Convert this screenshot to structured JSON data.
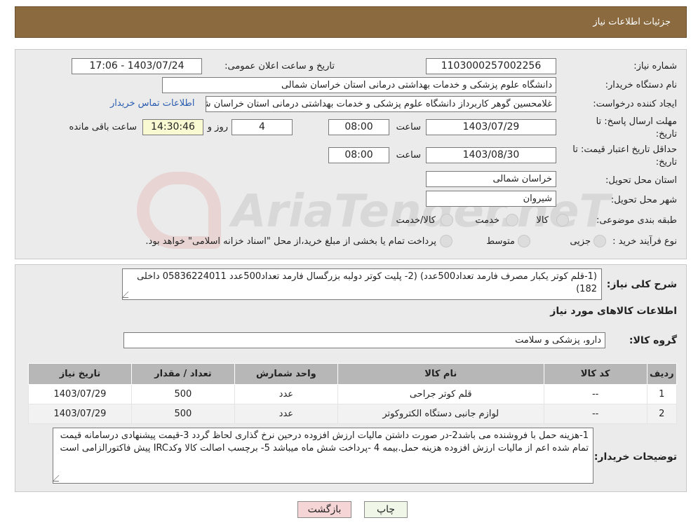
{
  "header": {
    "title": "جزئیات اطلاعات نیاز"
  },
  "form": {
    "need_number_label": "شماره نیاز:",
    "need_number": "1103000257002256",
    "announce_label": "تاریخ و ساعت اعلان عمومی:",
    "announce_value": "1403/07/24 - 17:06",
    "buyer_org_label": "نام دستگاه خریدار:",
    "buyer_org": "دانشگاه علوم پزشکی و خدمات بهداشتی درمانی استان خراسان شمالی",
    "creator_label": "ایجاد کننده درخواست:",
    "creator": "غلامحسین گوهر کاربرداز  دانشگاه علوم پزشکی و خدمات بهداشتی درمانی استان خراسان شمالی",
    "contact_link": "اطلاعات تماس خریدار",
    "deadline_label_1": "مهلت ارسال پاسخ: تا",
    "deadline_label_2": "تاریخ:",
    "deadline_date": "1403/07/29",
    "time_label": "ساعت",
    "deadline_time": "08:00",
    "days_value": "4",
    "days_label": "روز و",
    "remaining_time": "14:30:46",
    "remaining_label": "ساعت باقی مانده",
    "validity_label_1": "حداقل تاریخ اعتبار قیمت: تا",
    "validity_label_2": "تاریخ:",
    "validity_date": "1403/08/30",
    "validity_time": "08:00",
    "province_label": "استان محل تحویل:",
    "province": "خراسان شمالی",
    "city_label": "شهر محل تحویل:",
    "city": "شیروان",
    "category_label": "طبقه بندی موضوعی:",
    "category_options": [
      "کالا",
      "خدمت",
      "کالا/خدمت"
    ],
    "purchase_type_label": "نوع فرآیند خرید :",
    "purchase_options": [
      "جزیی",
      "متوسط"
    ],
    "purchase_note": "پرداخت تمام یا بخشی از مبلغ خرید،از محل \"اسناد خزانه اسلامی\" خواهد بود."
  },
  "details": {
    "summary_label": "شرح کلی نیاز:",
    "summary": "(1-قلم کوتر یکبار مصرف فارمد تعداد500عدد) (2- پلیت کوتر دولبه بزرگسال فارمد تعداد500عدد 05836224011 داخلی 182)",
    "items_heading": "اطلاعات کالاهای مورد نیاز",
    "group_label": "گروه کالا:",
    "group_value": "دارو، پزشکی و سلامت",
    "table_headers": [
      "ردیف",
      "کد کالا",
      "نام کالا",
      "واحد شمارش",
      "تعداد / مقدار",
      "تاریخ نیاز"
    ],
    "rows": [
      [
        "1",
        "--",
        "قلم کوتر جراحی",
        "عدد",
        "500",
        "1403/07/29"
      ],
      [
        "2",
        "--",
        "لوازم جانبی دستگاه الکتروکوتر",
        "عدد",
        "500",
        "1403/07/29"
      ]
    ],
    "buyer_notes_label": "توضیحات خریدار:",
    "buyer_notes": "1-هزینه حمل با فروشنده می باشد2-در صورت داشتن مالیات ارزش افزوده درحین نرخ گذاری لحاظ گردد 3-قیمت پیشنهادی درسامانه  قیمت تمام شده اعم از مالیات ارزش افزوده هزینه حمل.بیمه  4 -پرداخت شش ماه میباشد 5- برچسب اصالت کالا وکدIRC پیش فاکتورالزامی است"
  },
  "buttons": {
    "print": "چاپ",
    "back": "بازگشت"
  },
  "watermark": "AriaTender.neT",
  "colors": {
    "header_bg": "#8b6a40",
    "panel_bg": "#ebebeb",
    "back_btn": "#f5d5d5",
    "print_btn": "#f0f7e8"
  }
}
